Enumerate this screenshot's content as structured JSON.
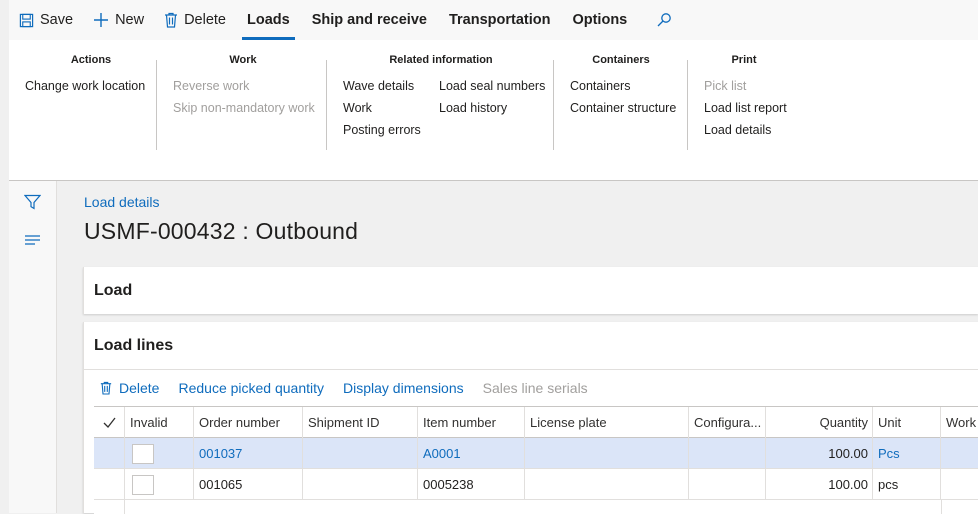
{
  "commands": {
    "save": "Save",
    "new": "New",
    "delete": "Delete",
    "tabs": [
      "Loads",
      "Ship and receive",
      "Transportation",
      "Options"
    ],
    "active_tab": "Loads"
  },
  "ribbon": {
    "actions": {
      "title": "Actions",
      "items": [
        "Change work location"
      ]
    },
    "work": {
      "title": "Work",
      "items": [
        "Reverse work",
        "Skip non-mandatory work"
      ]
    },
    "related": {
      "title": "Related information",
      "col1": [
        "Wave details",
        "Work",
        "Posting errors"
      ],
      "col2": [
        "Load seal numbers",
        "Load history"
      ]
    },
    "containers": {
      "title": "Containers",
      "items": [
        "Containers",
        "Container structure"
      ]
    },
    "print": {
      "title": "Print",
      "items": [
        "Pick list",
        "Load list report",
        "Load details"
      ]
    }
  },
  "page": {
    "breadcrumb": "Load details",
    "title": "USMF-000432 : Outbound"
  },
  "sections": {
    "load": "Load",
    "load_lines": "Load lines"
  },
  "lines_toolbar": {
    "delete": "Delete",
    "reduce": "Reduce picked quantity",
    "dimensions": "Display dimensions",
    "serials": "Sales line serials"
  },
  "grid": {
    "headers": [
      "Invalid",
      "Order number",
      "Shipment ID",
      "Item number",
      "License plate",
      "Configura...",
      "Quantity",
      "Unit",
      "Work"
    ],
    "rows": [
      {
        "order": "001037",
        "shipment": "",
        "item": "A0001",
        "license": "",
        "config": "",
        "quantity": "100.00",
        "unit": "Pcs",
        "selected": true
      },
      {
        "order": "001065",
        "shipment": "",
        "item": "0005238",
        "license": "",
        "config": "",
        "quantity": "100.00",
        "unit": "pcs",
        "selected": false
      }
    ]
  },
  "colors": {
    "accent": "#0f6cbd",
    "selected_row": "#dbe5f8",
    "disabled": "#a19f9d"
  }
}
